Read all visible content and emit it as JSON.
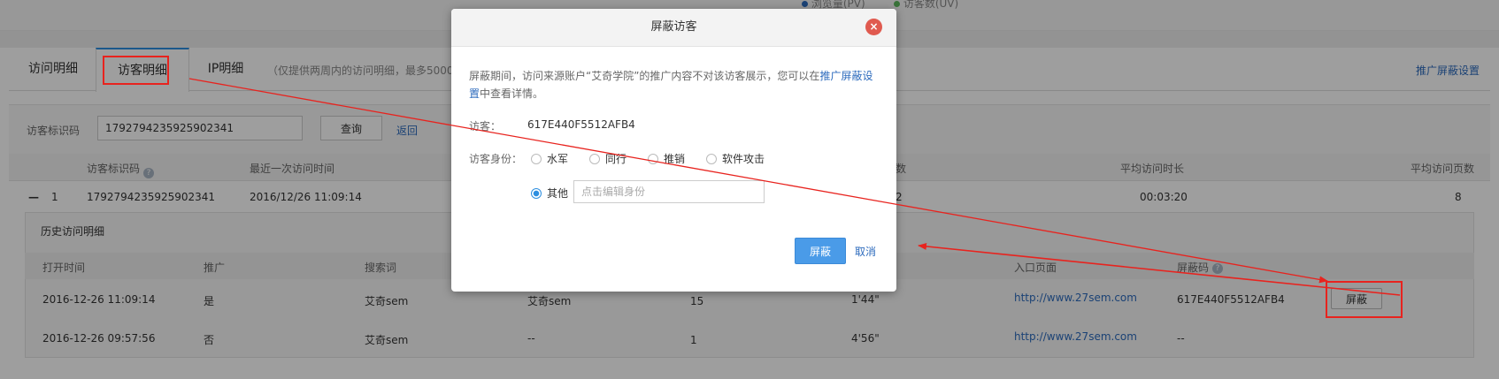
{
  "top_legend": {
    "pv_label": "浏览量(PV)",
    "uv_label": "访客数(UV)",
    "pv_color": "#2d6bbd",
    "uv_color": "#5cb85c"
  },
  "tabs": [
    {
      "label": "访问明细"
    },
    {
      "label": "访客明细"
    },
    {
      "label": "IP明细"
    }
  ],
  "tab_note": "（仅提供两周内的访问明细，最多5000",
  "shield_settings_link": "推广屏蔽设置",
  "search": {
    "label": "访客标识码",
    "value": "1792794235925902341",
    "button": "查询",
    "back": "返回"
  },
  "table": {
    "headers": {
      "visitor_id": "访客标识码",
      "last_visit": "最近一次访问时间",
      "visits_suffix": "数",
      "avg_duration": "平均访问时长",
      "avg_pages": "平均访问页数"
    },
    "row": {
      "toggle": "—",
      "index": "1",
      "visitor_id": "1792794235925902341",
      "last_visit": "2016/12/26 11:09:14",
      "visits": "2",
      "avg_duration": "00:03:20",
      "avg_pages": "8"
    }
  },
  "history": {
    "title": "历史访问明细",
    "headers": {
      "open_time": "打开时间",
      "promo": "推广",
      "search_word": "搜索词",
      "entry_page": "入口页面",
      "shield_code": "屏蔽码"
    },
    "rows": [
      {
        "open_time": "2016-12-26 11:09:14",
        "promo": "是",
        "search_word": "艾奇sem",
        "keyword": "艾奇sem",
        "pages": "15",
        "duration": "1'44\"",
        "entry": "http://www.27sem.com",
        "code": "617E440F5512AFB4",
        "action": "屏蔽"
      },
      {
        "open_time": "2016-12-26 09:57:56",
        "promo": "否",
        "search_word": "艾奇sem",
        "keyword": "--",
        "pages": "1",
        "duration": "4'56\"",
        "entry": "http://www.27sem.com",
        "code": "--"
      }
    ]
  },
  "dialog": {
    "title": "屏蔽访客",
    "close_icon": "×",
    "desc_prefix": "屏蔽期间，访问来源账户“艾奇学院”的推广内容不对该访客展示，您可以在",
    "desc_link": "推广屏蔽设置",
    "desc_suffix": "中查看详情。",
    "visitor_label": "访客：",
    "visitor_value": "617E440F5512AFB4",
    "identity_label": "访客身份：",
    "options": [
      "水军",
      "同行",
      "推销",
      "软件攻击"
    ],
    "other_label": "其他",
    "other_placeholder": "点击编辑身份",
    "confirm": "屏蔽",
    "cancel": "取消"
  }
}
